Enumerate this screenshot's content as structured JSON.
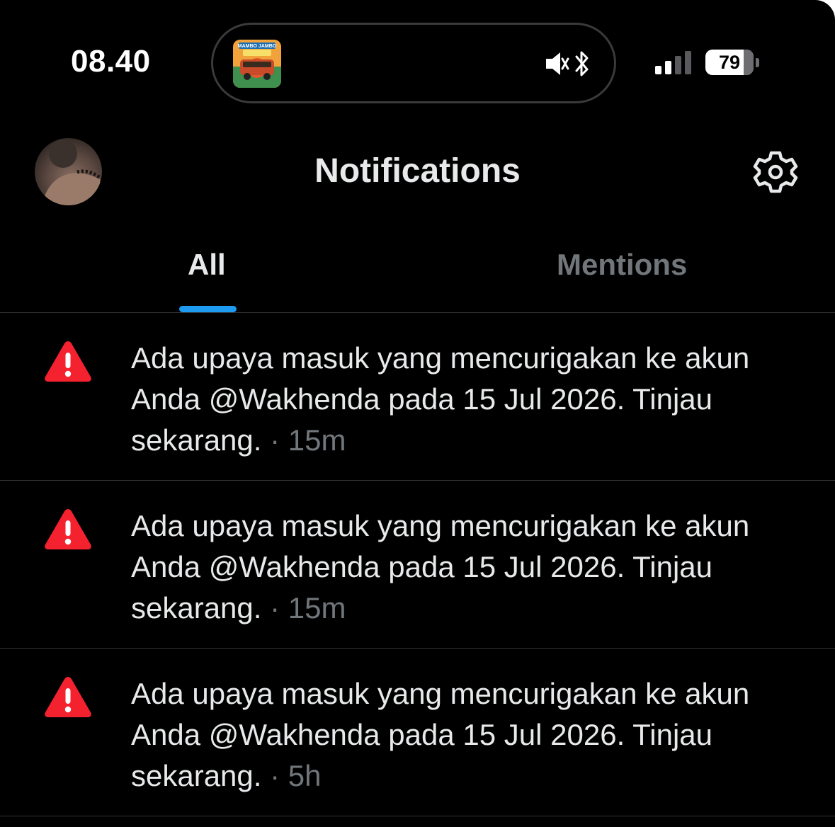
{
  "status_bar": {
    "time": "08.40",
    "now_playing_art_text": "MAMBO JAMBO",
    "battery_percent": "79",
    "battery_level": 0.79,
    "signal_bars_active": 2,
    "signal_bars_total": 4
  },
  "header": {
    "title": "Notifications"
  },
  "tabs": [
    {
      "label": "All",
      "active": true
    },
    {
      "label": "Mentions",
      "active": false
    }
  ],
  "notifications": [
    {
      "icon": "warning-icon",
      "text": "Ada upaya masuk yang mencurigakan ke akun Anda @Wakhenda pada 15 Jul 2026. Tinjau sekarang.",
      "separator": " · ",
      "time": "15m"
    },
    {
      "icon": "warning-icon",
      "text": "Ada upaya masuk yang mencurigakan ke akun Anda @Wakhenda pada 15 Jul 2026. Tinjau sekarang.",
      "separator": " · ",
      "time": "15m"
    },
    {
      "icon": "warning-icon",
      "text": "Ada upaya masuk yang mencurigakan ke akun Anda @Wakhenda pada 15 Jul 2026. Tinjau sekarang.",
      "separator": " · ",
      "time": "5h"
    }
  ],
  "colors": {
    "background": "#000000",
    "text_primary": "#e7e9ea",
    "text_secondary": "#71767b",
    "accent": "#1d9bf0",
    "warning": "#f4212e",
    "divider": "#2f3336"
  }
}
